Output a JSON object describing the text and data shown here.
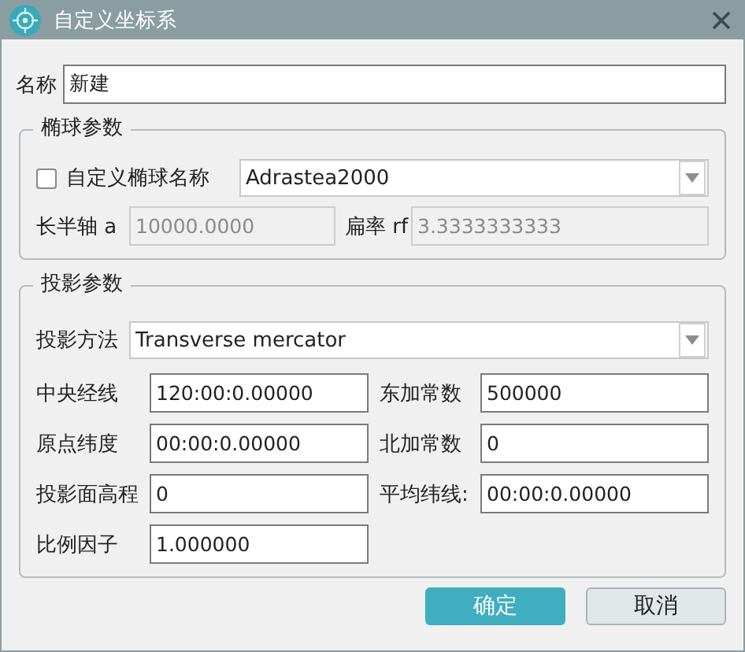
{
  "window": {
    "title": "自定义坐标系"
  },
  "name_field": {
    "label": "名称",
    "value": "新建"
  },
  "ellipsoid_group": {
    "title": "椭球参数",
    "custom_name": {
      "label": "自定义椭球名称",
      "checked": false
    },
    "ellipsoid": {
      "value": "Adrastea2000"
    },
    "fields": [
      {
        "label": "长半轴 a",
        "value": "10000.0000",
        "disabled": true
      },
      {
        "label": "扁率 rf",
        "value": "3.3333333333",
        "disabled": true
      }
    ]
  },
  "projection_group": {
    "title": "投影参数",
    "method": {
      "label": "投影方法",
      "value": "Transverse mercator"
    },
    "fields": [
      {
        "label": "中央经线",
        "value": "120:00:0.00000"
      },
      {
        "label": "东加常数",
        "value": "500000"
      },
      {
        "label": "原点纬度",
        "value": "00:00:0.00000"
      },
      {
        "label": "北加常数",
        "value": "0"
      },
      {
        "label": "投影面高程",
        "value": "0"
      },
      {
        "label": "平均纬线:",
        "value": "00:00:0.00000"
      },
      {
        "label": "比例因子",
        "value": "1.000000"
      }
    ]
  },
  "buttons": [
    {
      "label": "确定",
      "kind": "primary"
    },
    {
      "label": "取消",
      "kind": "secondary"
    }
  ]
}
